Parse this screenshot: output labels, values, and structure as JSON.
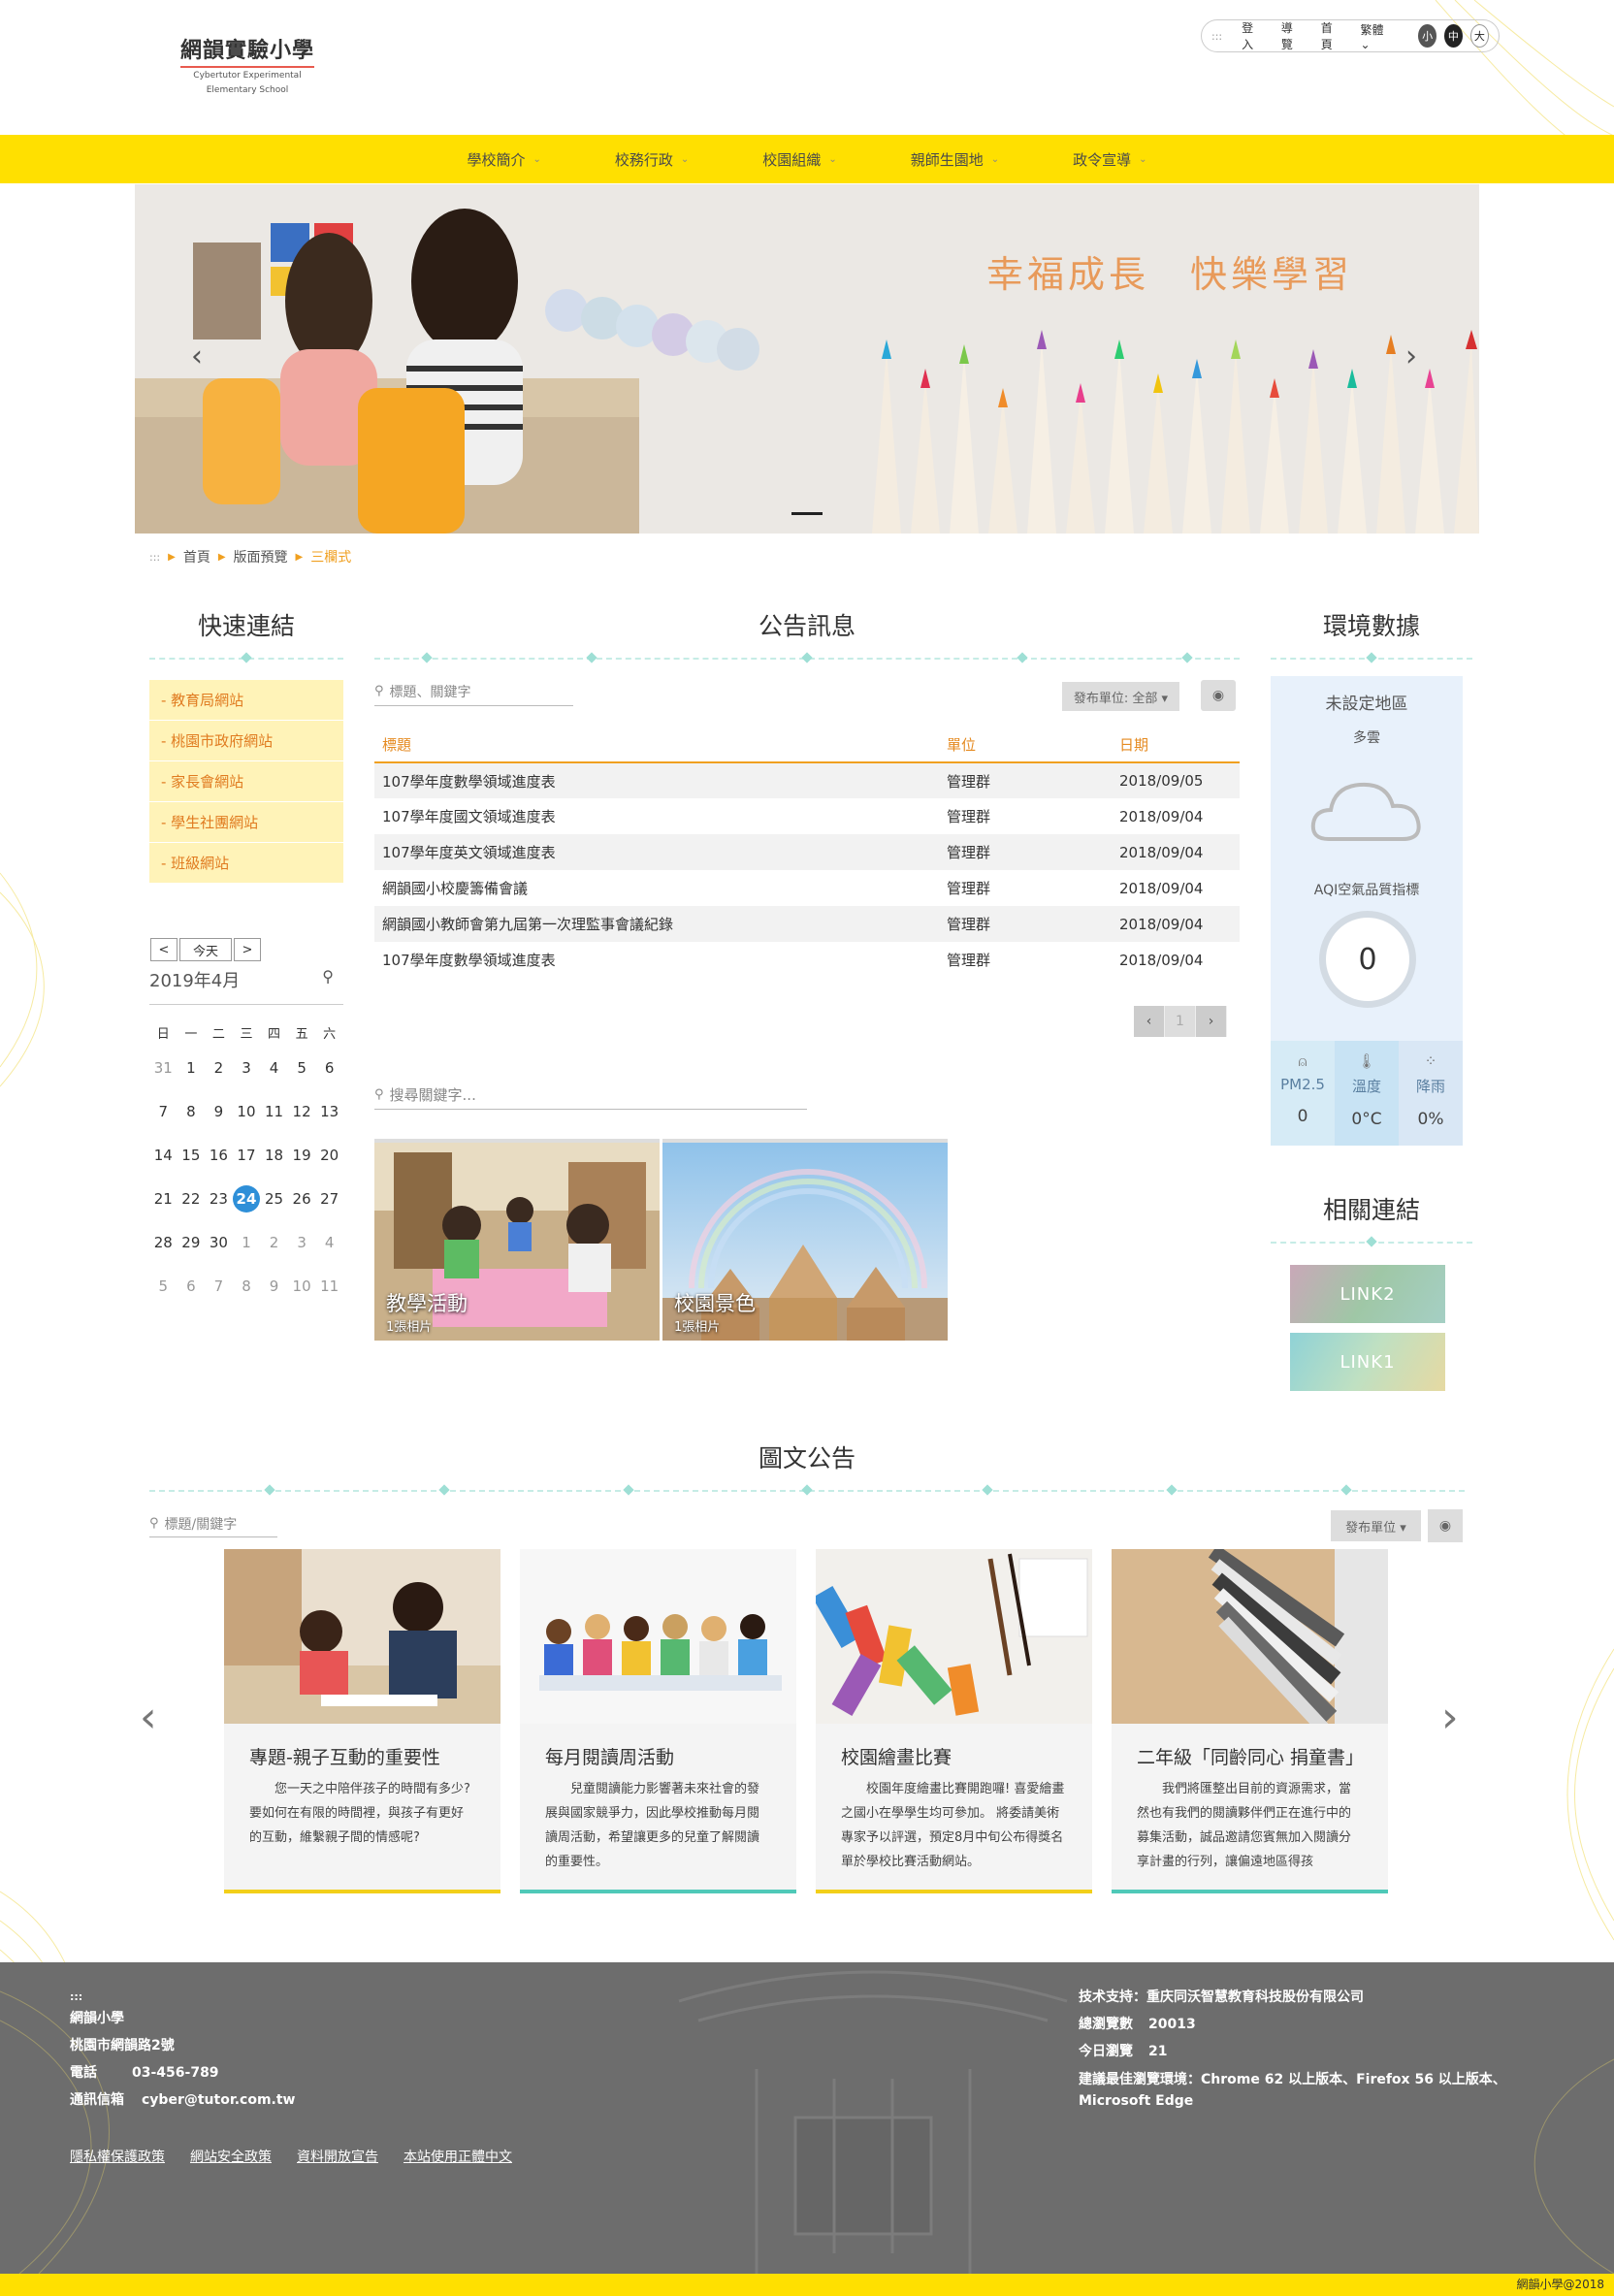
{
  "header": {
    "school_name": "網韻實驗小學",
    "school_en_line1": "Cybertutor Experimental",
    "school_en_line2": "Elementary School",
    "topbar": {
      "dots": ":::",
      "login": "登入",
      "guide": "導覽",
      "home": "首頁",
      "language": "繁體",
      "font_small": "小",
      "font_medium": "中",
      "font_large": "大"
    }
  },
  "nav": {
    "items": [
      "學校簡介",
      "校務行政",
      "校園組織",
      "親師生園地",
      "政令宣導"
    ]
  },
  "banner": {
    "slogan": "幸福成長　快樂學習",
    "prev": "‹",
    "next": "›"
  },
  "breadcrumb": {
    "dots": ":::",
    "items": [
      "首頁",
      "版面預覽",
      "三欄式"
    ]
  },
  "quick_links": {
    "title": "快速連結",
    "items": [
      "- 教育局網站",
      "- 桃園市政府網站",
      "- 家長會網站",
      "- 學生社團網站",
      "- 班級網站"
    ]
  },
  "calendar": {
    "prev": "<",
    "today": "今天",
    "next": ">",
    "month_label": "2019年4月",
    "weekdays": [
      "日",
      "一",
      "二",
      "三",
      "四",
      "五",
      "六"
    ],
    "weeks": [
      [
        "31",
        "1",
        "2",
        "3",
        "4",
        "5",
        "6"
      ],
      [
        "7",
        "8",
        "9",
        "10",
        "11",
        "12",
        "13"
      ],
      [
        "14",
        "15",
        "16",
        "17",
        "18",
        "19",
        "20"
      ],
      [
        "21",
        "22",
        "23",
        "24",
        "25",
        "26",
        "27"
      ],
      [
        "28",
        "29",
        "30",
        "1",
        "2",
        "3",
        "4"
      ],
      [
        "5",
        "6",
        "7",
        "8",
        "9",
        "10",
        "11"
      ]
    ],
    "today_date": "24"
  },
  "announcements": {
    "title": "公告訊息",
    "search_placeholder": "標題、關鍵字",
    "unit_filter": "發布單位: 全部 ▾",
    "columns": [
      "標題",
      "單位",
      "日期"
    ],
    "rows": [
      [
        "107學年度數學領域進度表",
        "管理群",
        "2018/09/05"
      ],
      [
        "107學年度國文領域進度表",
        "管理群",
        "2018/09/04"
      ],
      [
        "107學年度英文領域進度表",
        "管理群",
        "2018/09/04"
      ],
      [
        "網韻國小校慶籌備會議",
        "管理群",
        "2018/09/04"
      ],
      [
        "網韻國小教師會第九屆第一次理監事會議紀錄",
        "管理群",
        "2018/09/04"
      ],
      [
        "107學年度數學領域進度表",
        "管理群",
        "2018/09/04"
      ]
    ],
    "page": "1"
  },
  "albums": {
    "search_placeholder": "搜尋關鍵字...",
    "items": [
      {
        "title": "教學活動",
        "count": "1張相片"
      },
      {
        "title": "校園景色",
        "count": "1張相片"
      }
    ]
  },
  "environment": {
    "title": "環境數據",
    "region": "未設定地區",
    "weather": "多雲",
    "aqi_label": "AQI空氣品質指標",
    "aqi_value": "0",
    "stats": [
      {
        "label": "PM2.5",
        "value": "0",
        "icon": "mask-icon"
      },
      {
        "label": "溫度",
        "value": "0°C",
        "icon": "thermometer-icon"
      },
      {
        "label": "降雨",
        "value": "0%",
        "icon": "raindrops-icon"
      }
    ]
  },
  "related_links": {
    "title": "相關連結",
    "items": [
      "LINK2",
      "LINK1"
    ]
  },
  "picture_announcements": {
    "title": "圖文公告",
    "search_placeholder": "標題/關鍵字",
    "unit_filter": "發布單位 ▾",
    "prev": "‹",
    "next": "›",
    "cards": [
      {
        "title": "專題-親子互動的重要性",
        "text": "您一天之中陪伴孩子的時間有多少?要如何在有限的時間裡，與孩子有更好的互動，維繫親子間的情感呢?",
        "accent": "#f2cf1a"
      },
      {
        "title": "每月閱讀周活動",
        "text": "兒童閱讀能力影響著未來社會的發展與國家競爭力，因此學校推動每月閱讀周活動，希望讓更多的兒童了解閱讀的重要性。",
        "accent": "#4fc9b8"
      },
      {
        "title": "校園繪畫比賽",
        "text": "校園年度繪畫比賽開跑囉! 喜愛繪畫之國小在學學生均可參加。 將委請美術專家予以評選，預定8月中旬公布得獎名單於學校比賽活動網站。",
        "accent": "#f2cf1a"
      },
      {
        "title": "二年級「同齡同心 捐童書」",
        "text": "我們將匯整出目前的資源需求，當然也有我們的閱讀夥伴們正在進行中的募集活動，誠品邀請您賓無加入閱讀分享計畫的行列，讓偏遠地區得孩",
        "accent": "#4fc9b8"
      }
    ]
  },
  "footer": {
    "dots": ":::",
    "school": "網韻小學",
    "address": "桃園市網韻路2號",
    "phone_label": "電話",
    "phone": "03-456-789",
    "email_label": "通訊信箱",
    "email": "cyber@tutor.com.tw",
    "support": "技术支持：重庆同沃智慧教育科技股份有限公司",
    "total_visits_label": "總瀏覽數",
    "total_visits": "20013",
    "today_visits_label": "今日瀏覽",
    "today_visits": "21",
    "browser_note": "建議最佳瀏覽環境：Chrome 62 以上版本、Firefox 56 以上版本、Microsoft Edge",
    "links": [
      "隱私權保護政策",
      "網站安全政策",
      "資料開放宣告",
      "本站使用正體中文"
    ],
    "copyright": "網韻小學@2018"
  },
  "colors": {
    "brand_yellow": "#ffe000",
    "accent_orange": "#f0a020",
    "teal": "#4fc9b8",
    "today_blue": "#2e8fd8"
  }
}
